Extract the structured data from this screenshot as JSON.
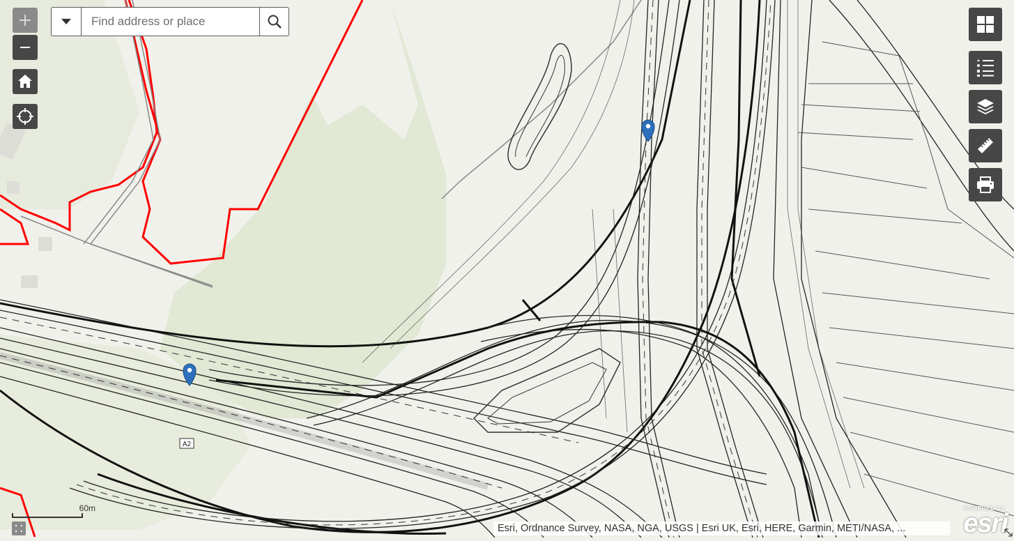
{
  "zoom": {
    "in_label": "+",
    "out_label": "−"
  },
  "search": {
    "placeholder": "Find address or place",
    "value": ""
  },
  "scalebar": {
    "label": "60m"
  },
  "attribution": "Esri, Ordnance Survey, NASA, NGA, USGS | Esri UK, Esri, HERE, Garmin, METI/NASA, ...",
  "esri_logo": {
    "powered_by": "POWERED BY",
    "brand": "esri"
  },
  "road_label": "A2",
  "tools": [
    "basemap-gallery-icon",
    "legend-icon",
    "layers-icon",
    "measure-icon",
    "print-icon"
  ],
  "colors": {
    "boundary": "#ff0000",
    "marker": "#2d6fba",
    "control": "#474747",
    "green_area": "#dfe7d1",
    "base": "#f1f1ec"
  }
}
